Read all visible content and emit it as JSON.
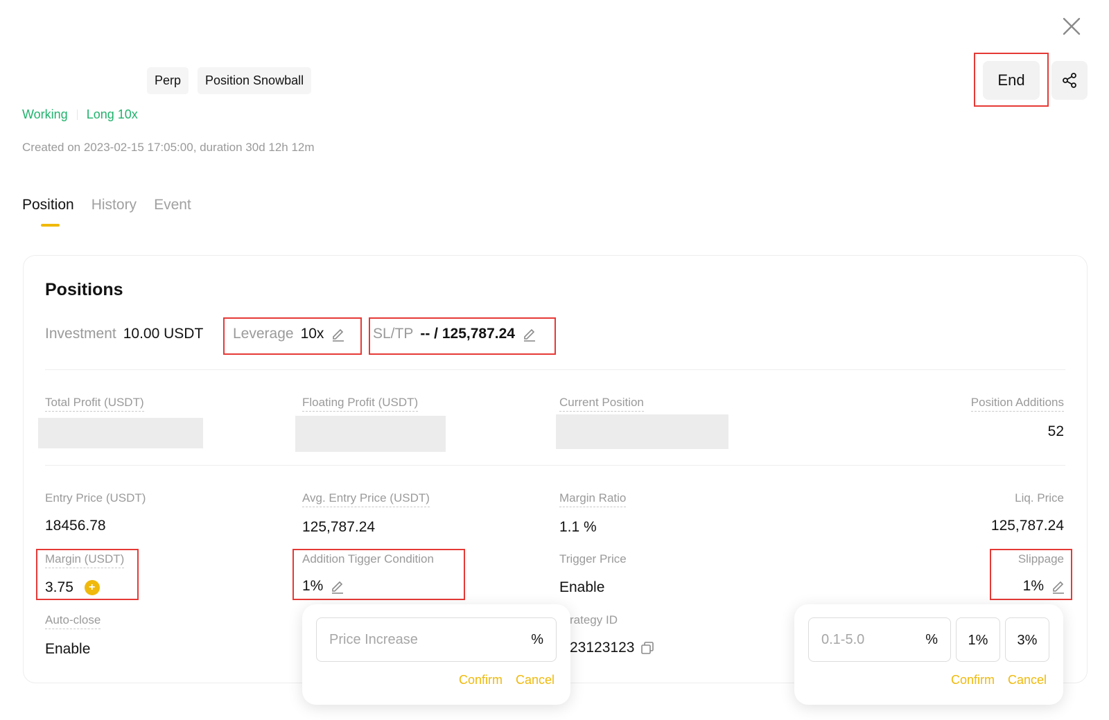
{
  "header": {
    "tags": [
      "Perp",
      "Position Snowball"
    ],
    "status": "Working",
    "direction": "Long 10x",
    "created": "Created on 2023-02-15 17:05:00, duration 30d 12h 12m",
    "end_label": "End"
  },
  "tabs": [
    {
      "label": "Position",
      "active": true
    },
    {
      "label": "History",
      "active": false
    },
    {
      "label": "Event",
      "active": false
    }
  ],
  "positions": {
    "title": "Positions",
    "investment_label": "Investment",
    "investment_value": "10.00 USDT",
    "leverage_label": "Leverage",
    "leverage_value": "10x",
    "sltp_label": "SL/TP",
    "sltp_value": "-- / 125,787.24",
    "total_profit_label": "Total Profit (USDT)",
    "floating_profit_label": "Floating Profit (USDT)",
    "current_position_label": "Current Position",
    "position_additions_label": "Position Additions",
    "position_additions_value": "52",
    "entry_price_label": "Entry Price (USDT)",
    "entry_price_value": "18456.78",
    "avg_entry_label": "Avg. Entry Price (USDT)",
    "avg_entry_value": "125,787.24",
    "margin_ratio_label": "Margin Ratio",
    "margin_ratio_value": "1.1 %",
    "liq_price_label": "Liq. Price",
    "liq_price_value": "125,787.24",
    "margin_label": "Margin (USDT)",
    "margin_value": "3.75",
    "addition_trigger_label": "Addition Tigger Condition",
    "addition_trigger_value": "1%",
    "trigger_price_label": "Trigger Price",
    "trigger_price_value": "Enable",
    "slippage_label": "Slippage",
    "slippage_value": "1%",
    "auto_close_label": "Auto-close",
    "auto_close_value": "Enable",
    "strategy_id_label": "rategy ID",
    "strategy_id_value": "23123123"
  },
  "popup_trigger": {
    "placeholder": "Price Increase",
    "unit": "%",
    "confirm": "Confirm",
    "cancel": "Cancel"
  },
  "popup_slippage": {
    "placeholder": "0.1-5.0",
    "unit": "%",
    "chips": [
      "1%",
      "3%"
    ],
    "confirm": "Confirm",
    "cancel": "Cancel"
  },
  "colors": {
    "accent": "#f0b90b",
    "status_green": "#20b26c",
    "highlight_red": "#e53935"
  }
}
